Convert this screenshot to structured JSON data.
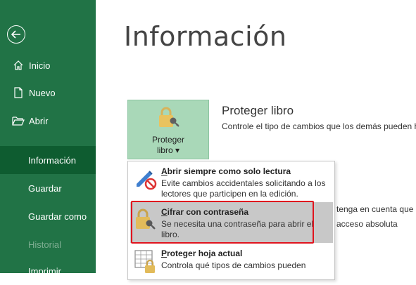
{
  "sidebar": {
    "items": [
      {
        "label": "Inicio"
      },
      {
        "label": "Nuevo"
      },
      {
        "label": "Abrir"
      },
      {
        "label": "Información"
      },
      {
        "label": "Guardar"
      },
      {
        "label": "Guardar como"
      },
      {
        "label": "Historial"
      },
      {
        "label": "Imprimir"
      }
    ]
  },
  "main": {
    "title": "Información",
    "protect_button": {
      "line1": "Proteger",
      "line2": "libro ▾"
    },
    "section_title": "Proteger libro",
    "section_description": "Controle el tipo de cambios que los demás pueden h",
    "background_text_1": "tenga en cuenta que e",
    "background_text_2": "acceso absoluta"
  },
  "menu": {
    "items": [
      {
        "mnemonic": "A",
        "title_rest": "brir siempre como solo lectura",
        "description": "Evite cambios accidentales solicitando a los lectores que participen en la edición."
      },
      {
        "mnemonic": "C",
        "title_rest": "ifrar con contraseña",
        "description": "Se necesita una contraseña para abrir el libro."
      },
      {
        "mnemonic": "P",
        "title_rest": "roteger hoja actual",
        "description": "Controla qué tipos de cambios pueden"
      }
    ]
  },
  "colors": {
    "sidebar_bg": "#217346",
    "active_item": "#0e5c30",
    "tile_bg": "#a9d8b8",
    "highlight_frame": "#e0141e"
  }
}
